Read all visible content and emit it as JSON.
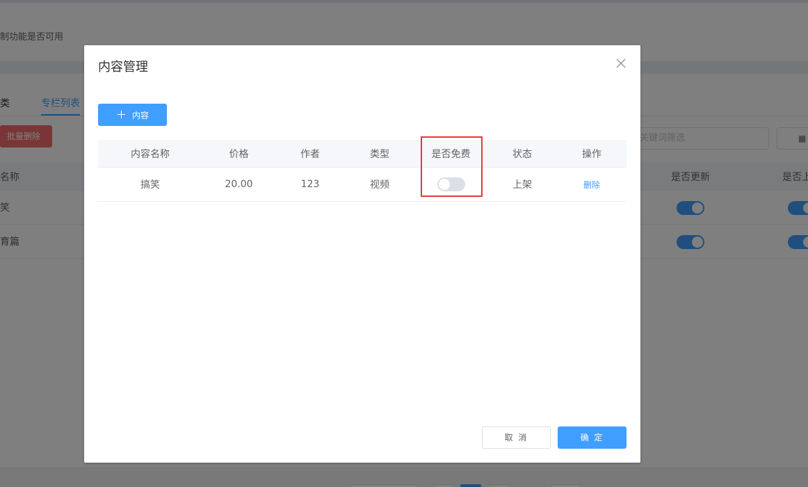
{
  "background": {
    "notice": "制功能是否可用",
    "tabs": [
      "分类",
      "专栏列表"
    ],
    "batch_delete_label": "批量删除",
    "search_placeholder": "关键词筛选",
    "view_button_icon": "grid-icon",
    "table_headers": {
      "name": "名称",
      "updated": "是否更新",
      "onshelf": "是否上"
    },
    "rows": [
      {
        "name": "笑",
        "updated": true,
        "onshelf": true
      },
      {
        "name": "育篇",
        "updated": true,
        "onshelf": true
      }
    ]
  },
  "dialog": {
    "title": "内容管理",
    "close_icon": "close-icon",
    "add_button": {
      "icon": "plus-icon",
      "label": "内容"
    },
    "table": {
      "columns": [
        "内容名称",
        "价格",
        "作者",
        "类型",
        "是否免费",
        "状态",
        "操作"
      ],
      "rows": [
        {
          "name": "搞笑",
          "price": "20.00",
          "author": "123",
          "type": "视频",
          "is_free": false,
          "status": "上架",
          "action": "删除"
        }
      ]
    },
    "footer": {
      "cancel_label": "取 消",
      "ok_label": "确 定"
    },
    "highlight_color": "#e53935",
    "accent_color": "#409eff"
  }
}
